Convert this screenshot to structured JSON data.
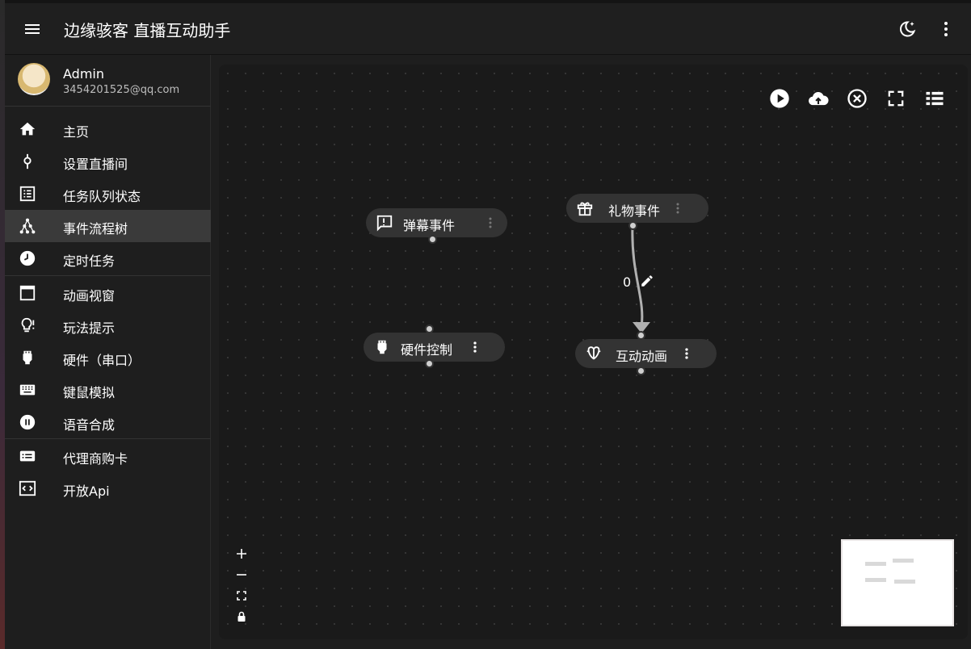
{
  "app": {
    "title": "边缘骇客 直播互动助手"
  },
  "user": {
    "name": "Admin",
    "email": "3454201525@qq.com"
  },
  "nav": {
    "groups": [
      [
        {
          "label": "主页",
          "icon": "home-icon"
        },
        {
          "label": "设置直播间",
          "icon": "pin-icon"
        },
        {
          "label": "任务队列状态",
          "icon": "list-icon"
        },
        {
          "label": "事件流程树",
          "icon": "tree-icon",
          "active": true
        },
        {
          "label": "定时任务",
          "icon": "clock-icon"
        }
      ],
      [
        {
          "label": "动画视窗",
          "icon": "window-icon"
        },
        {
          "label": "玩法提示",
          "icon": "bulb-icon"
        },
        {
          "label": "硬件（串口）",
          "icon": "plug-icon"
        },
        {
          "label": "键鼠模拟",
          "icon": "keyboard-icon"
        },
        {
          "label": "语音合成",
          "icon": "voice-icon"
        }
      ],
      [
        {
          "label": "代理商购卡",
          "icon": "card-icon"
        },
        {
          "label": "开放Api",
          "icon": "api-icon"
        }
      ]
    ]
  },
  "flow": {
    "nodes": {
      "danmu": {
        "label": "弹幕事件",
        "icon": "chat-icon"
      },
      "gift": {
        "label": "礼物事件",
        "icon": "gift-icon"
      },
      "hardware": {
        "label": "硬件控制",
        "icon": "plug-icon"
      },
      "animation": {
        "label": "互动动画",
        "icon": "animation-icon"
      }
    },
    "edge_label": "0"
  },
  "colors": {
    "background": "#1e1e1e",
    "node": "#333333",
    "active_nav": "#3a3a3a",
    "edge": "#b0b0b0"
  }
}
